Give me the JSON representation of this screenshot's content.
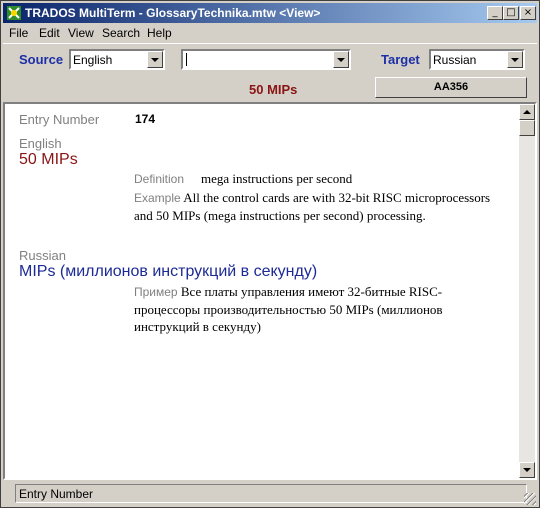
{
  "window": {
    "title": "TRADOS MultiTerm - GlossaryTechnika.mtw <View>",
    "buttons": {
      "minimize": "_",
      "maximize": "□",
      "close": "×"
    }
  },
  "menu": [
    "File",
    "Edit",
    "View",
    "Search",
    "Help"
  ],
  "toolbar": {
    "source_label": "Source",
    "source_value": "English",
    "search_value": "",
    "target_label": "Target",
    "target_value": "Russian",
    "current_term": "50 MIPs",
    "entry_button": "AA356"
  },
  "entry": {
    "number_label": "Entry Number",
    "number_value": "174",
    "source_lang": "English",
    "source_term": "50 MIPs",
    "definition_label": "Definition",
    "definition_text": "mega instructions per second",
    "example_label": "Example",
    "example_text": "All the control cards are with 32-bit RISC microprocessors and 50 MIPs (mega instructions per second) processing.",
    "target_lang": "Russian",
    "target_term": "MIPs (миллионов инструкций в секунду)",
    "target_example_label": "Пример",
    "target_example_text": "Все платы управления имеют 32-битные RISC-процессоры производительностью 50 MIPs (миллионов инструкций в секунду)"
  },
  "status": {
    "text": "Entry Number"
  },
  "colors": {
    "label_blue": "#1c2fa6",
    "term_red": "#8b1414",
    "target_blue": "#1c2a96",
    "title_dark": "#0a246a"
  }
}
